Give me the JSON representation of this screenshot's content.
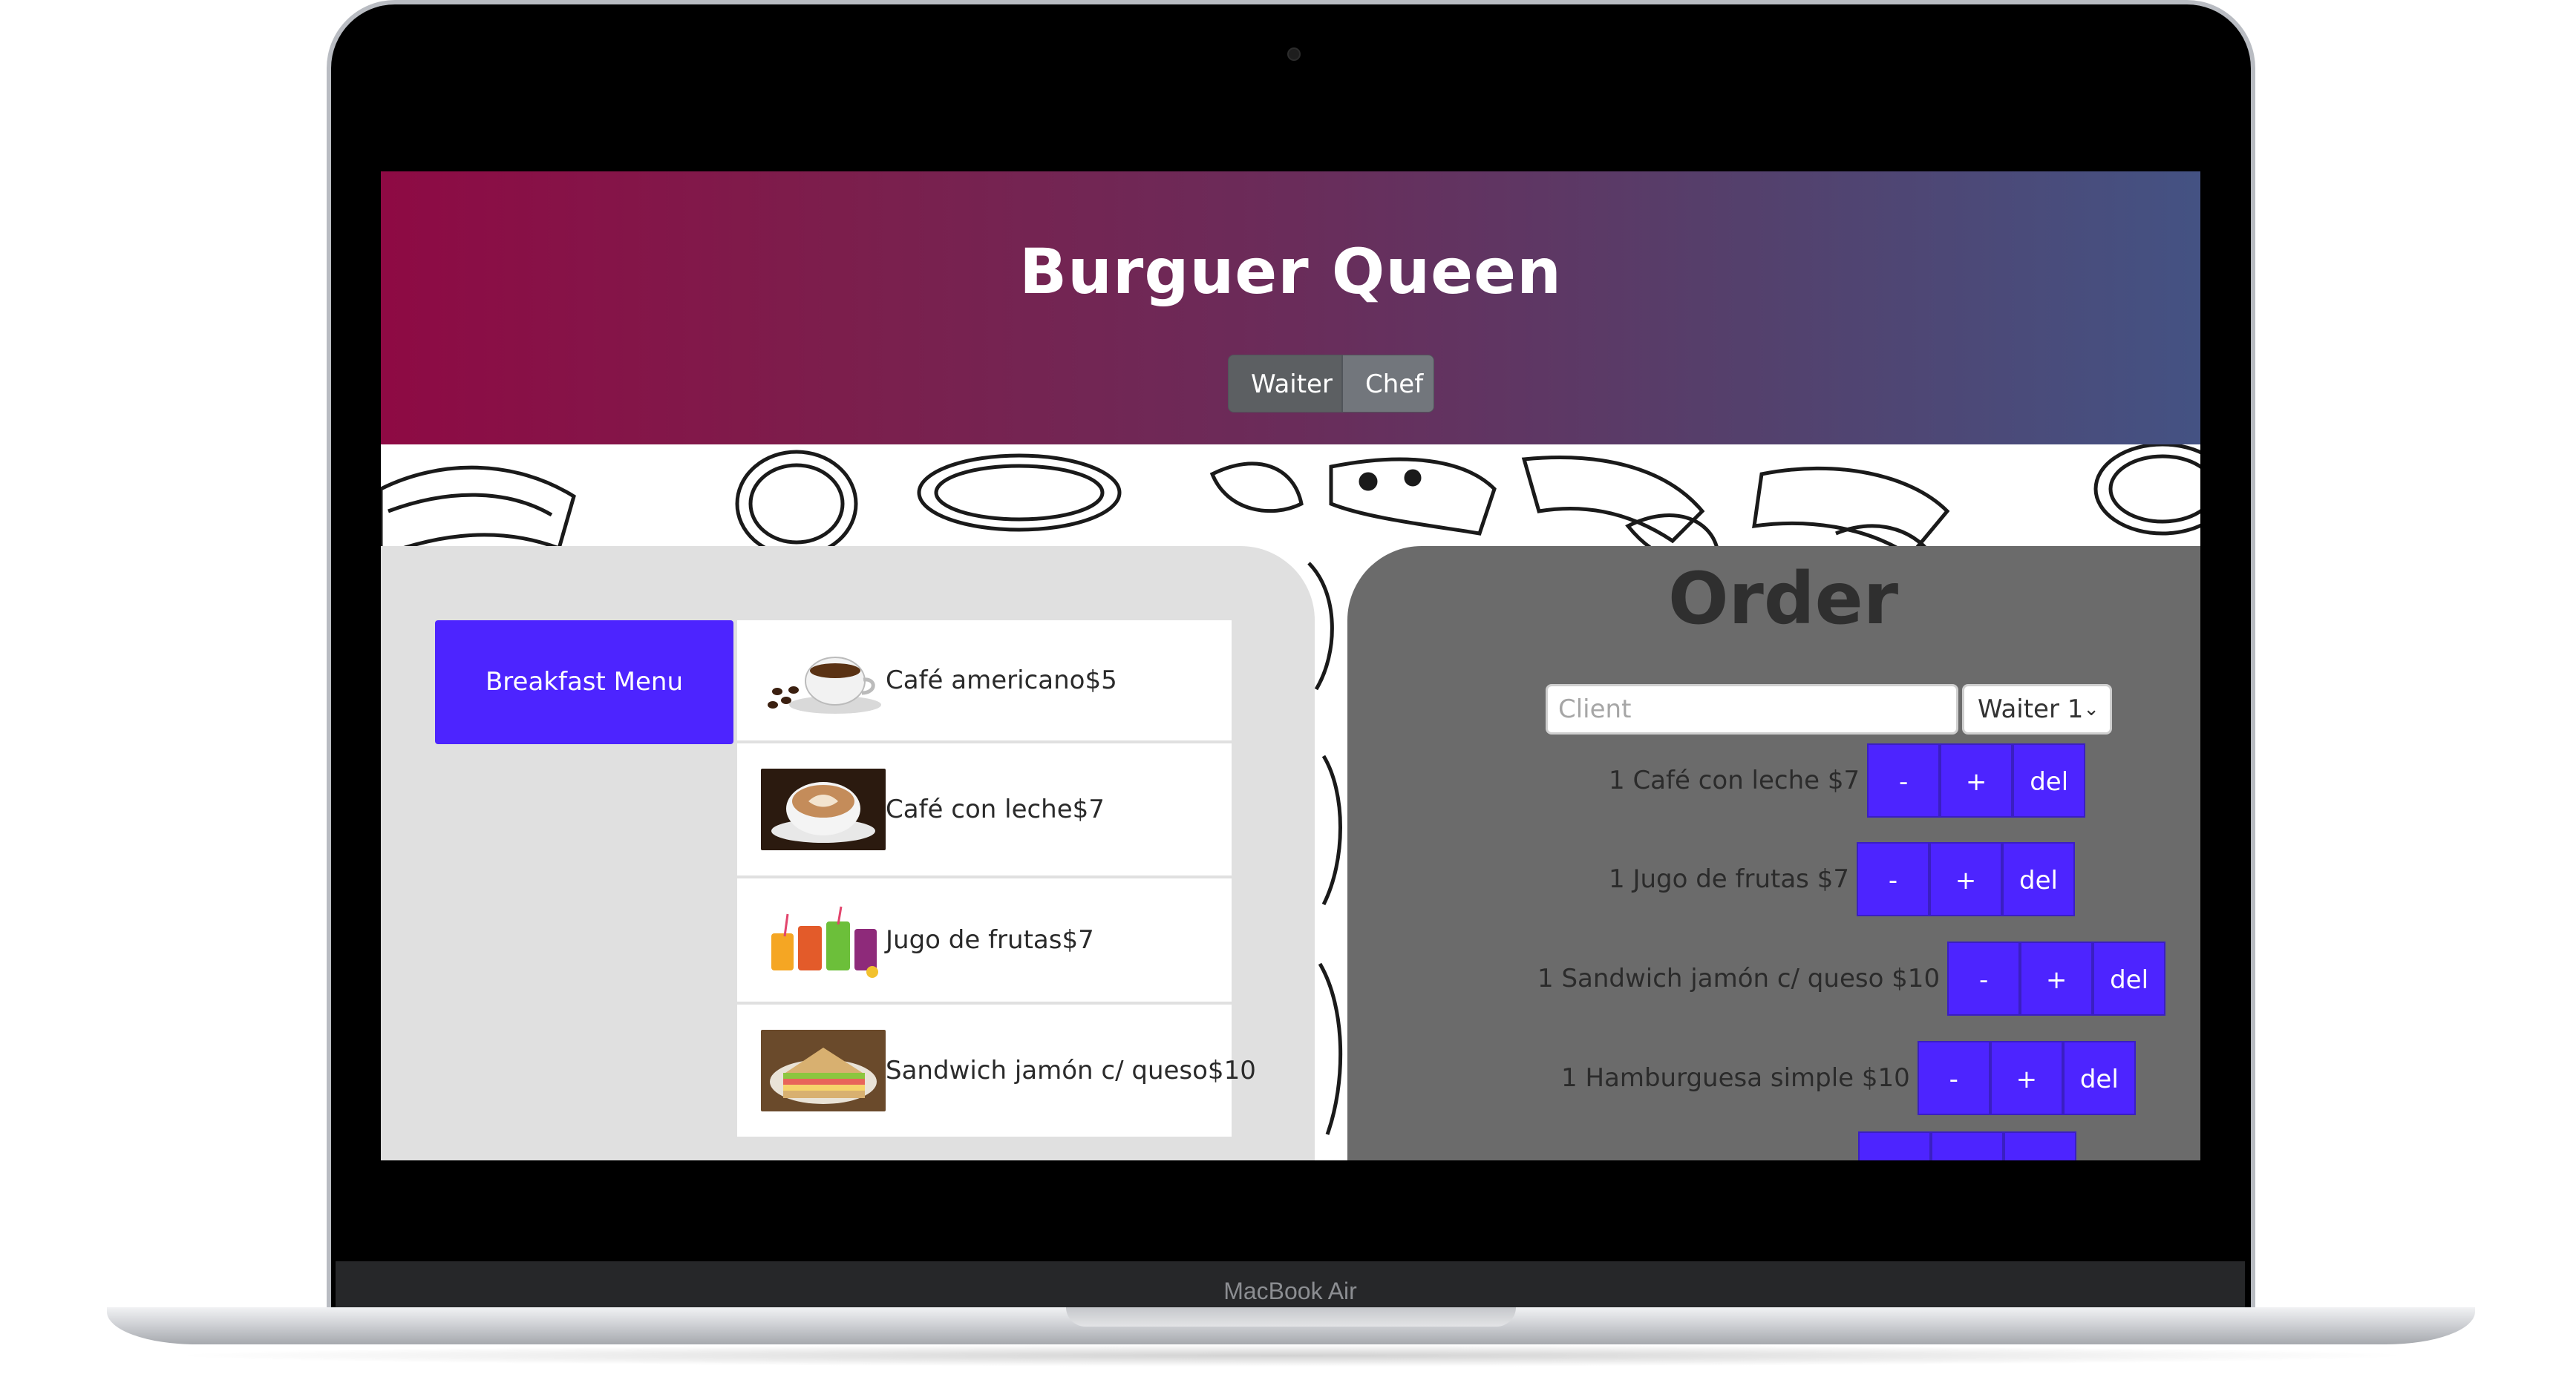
{
  "device": {
    "label": "MacBook Air"
  },
  "app": {
    "title": "Burguer Queen",
    "roles": [
      "Waiter",
      "Chef"
    ]
  },
  "menu": {
    "category_button": "Breakfast Menu",
    "items": [
      {
        "label": "Café americano$5",
        "icon": "coffee-beans-cup-image"
      },
      {
        "label": "Café con leche$7",
        "icon": "latte-cup-image"
      },
      {
        "label": "Jugo de frutas$7",
        "icon": "fruit-juices-image"
      },
      {
        "label": "Sandwich jamón c/ queso$10",
        "icon": "sandwich-image"
      }
    ]
  },
  "order": {
    "title": "Order",
    "client_placeholder": "Client",
    "waiter_selected": "Waiter 1",
    "buttons": {
      "minus": "-",
      "plus": "+",
      "del": "del"
    },
    "lines": [
      "1 Café con leche $7",
      "1 Jugo de frutas $7",
      "1 Sandwich jamón c/ queso $10",
      "1 Hamburguesa simple $10"
    ]
  },
  "colors": {
    "accent": "#4d24ff",
    "header_start": "#8e0a44",
    "header_end": "#445283",
    "order_panel": "#6b6b6b",
    "menu_panel": "#e0e0e0"
  }
}
